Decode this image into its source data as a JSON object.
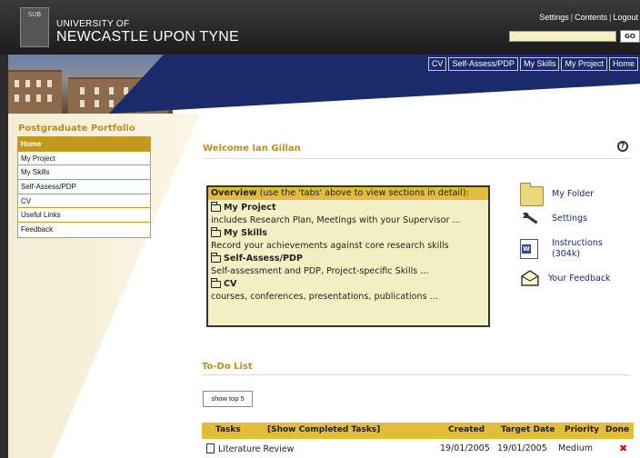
{
  "header": {
    "crest_text": "SUB",
    "uni_of": "UNIVERSITY OF",
    "uni_name": "NEWCASTLE UPON TYNE",
    "links": [
      "Settings",
      "Contents",
      "Logout"
    ],
    "search_value": "",
    "go_label": "GO"
  },
  "tabs": [
    "CV",
    "Self-Assess/PDP",
    "My Skills",
    "My Project",
    "Home"
  ],
  "sidebar": {
    "title": "Postgraduate Portfolio",
    "items": [
      {
        "label": "Home",
        "active": true
      },
      {
        "label": "My Project",
        "active": false
      },
      {
        "label": "My Skills",
        "active": false
      },
      {
        "label": "Self-Assess/PDP",
        "active": false
      },
      {
        "label": "CV",
        "active": false
      },
      {
        "label": "Useful Links",
        "active": false
      },
      {
        "label": "Feedback",
        "active": false
      }
    ]
  },
  "main": {
    "welcome": "Welcome Ian Gillan",
    "help_glyph": "?",
    "overview": {
      "head_bold": "Overview",
      "head_rest": " (use the 'tabs' above to view sections in detail):",
      "sections": [
        {
          "title": "My Project",
          "desc": "includes Research Plan, Meetings with your Supervisor ..."
        },
        {
          "title": "My Skills",
          "desc": "Record your achievements against core research skills"
        },
        {
          "title": "Self-Assess/PDP",
          "desc": "Self-assessment and PDP, Project-specific Skills ..."
        },
        {
          "title": "CV",
          "desc": "courses, conferences, presentations, publications ..."
        }
      ]
    },
    "quick_links": [
      {
        "label": "My Folder",
        "icon": "folder-icon"
      },
      {
        "label": "Settings",
        "icon": "wrench-icon"
      },
      {
        "label": "Instructions (304k)",
        "icon": "word-document-icon"
      },
      {
        "label": "Your Feedback",
        "icon": "envelope-icon"
      }
    ]
  },
  "todo": {
    "title": "To-Do List",
    "show_button": "show top 5",
    "columns": {
      "tasks": "Tasks",
      "show_completed": "[Show Completed Tasks]",
      "created": "Created",
      "target": "Target Date",
      "priority": "Priority",
      "done": "Done"
    },
    "rows": [
      {
        "task": "Literature Review",
        "created": "19/01/2005",
        "target": "19/01/2005",
        "priority": "Medium",
        "done_glyph": "✖"
      }
    ]
  }
}
